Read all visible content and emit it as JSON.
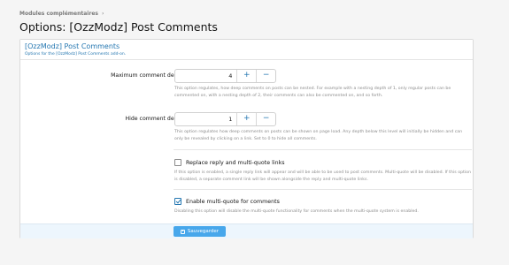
{
  "breadcrumb": {
    "item": "Modules complémentaires",
    "separator": "›"
  },
  "page_title": "Options: [OzzModz] Post Comments",
  "block": {
    "title": "[OzzModz] Post Comments",
    "description": "Options for the [OzzModz] Post Comments add-on."
  },
  "options": {
    "max_depth": {
      "label": "Maximum comment depth:",
      "value": "4",
      "plus": "+",
      "minus": "−",
      "explain": "This option regulates, how deep comments on posts can be nested. For example with a nesting depth of 1, only regular posts can be commented on, with a nesting depth of 2, their comments can also be commented on, and so forth."
    },
    "hide_depth": {
      "label": "Hide comment depth:",
      "value": "1",
      "plus": "+",
      "minus": "−",
      "explain": "This option regulates how deep comments on posts can be shown on page load. Any depth below this level will initially be hidden and can only be revealed by clicking on a link. Set to 0 to hide all comments."
    },
    "replace_reply": {
      "label": "Replace reply and multi-quote links",
      "checked": false,
      "explain": "If this option is enabled, a single reply link will appear and will be able to be used to post comments. Multi-quote will be disabled. If this option is disabled, a separate comment link will be shown alongside the reply and multi-quote links."
    },
    "enable_multiquote": {
      "label": "Enable multi-quote for comments",
      "checked": true,
      "explain": "Disabling this option will disable the multi-quote functionality for comments when the multi-quote system is enabled."
    }
  },
  "footer": {
    "save_label": "Sauvegarder",
    "save_icon": "save-icon"
  },
  "colors": {
    "accent": "#2577b1",
    "button": "#47a7eb",
    "footer_bg": "#edf6fd"
  }
}
